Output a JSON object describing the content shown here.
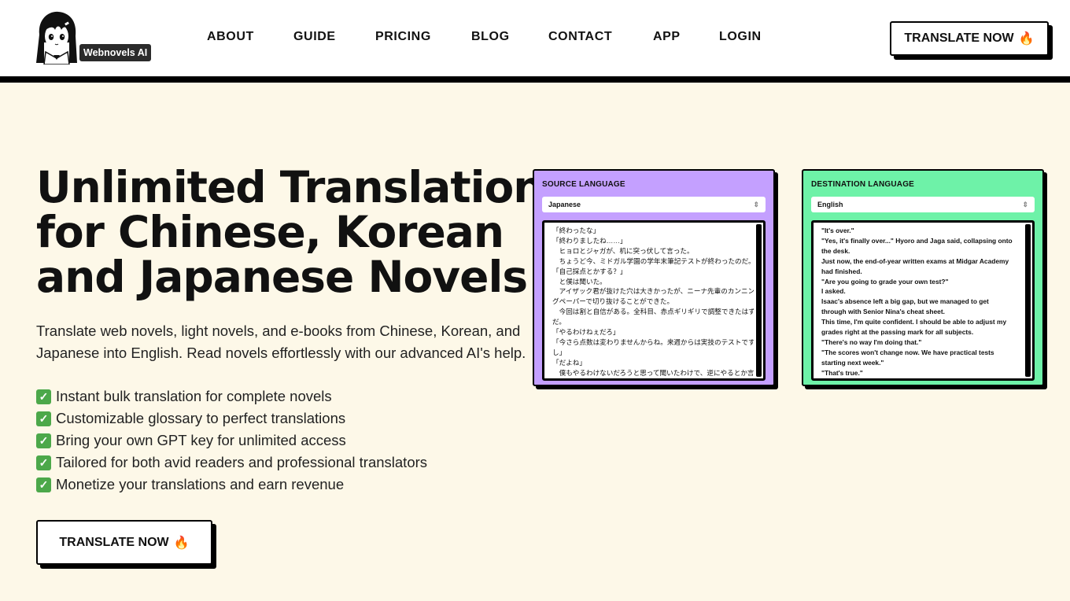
{
  "brand": {
    "name": "Webnovels AI"
  },
  "nav": {
    "items": [
      "ABOUT",
      "GUIDE",
      "PRICING",
      "BLOG",
      "CONTACT",
      "APP",
      "LOGIN"
    ]
  },
  "header_cta": {
    "label": "TRANSLATE NOW",
    "emoji": "🔥"
  },
  "hero": {
    "title_highlight": "Unlimited",
    "title_line1_rest": " Translation",
    "title_line2": "for Chinese, Korean",
    "title_line3": "and Japanese Novels",
    "description": "Translate web novels, light novels, and e-books from Chinese, Korean, and Japanese into English. Read novels effortlessly with our advanced AI's help.",
    "features": [
      "Instant bulk translation for complete novels",
      "Customizable glossary to perfect translations",
      "Bring your own GPT key for unlimited access",
      "Tailored for both avid readers and professional translators",
      "Monetize your translations and earn revenue"
    ],
    "cta_label": "TRANSLATE NOW",
    "cta_emoji": "🔥"
  },
  "source_panel": {
    "label": "SOURCE LANGUAGE",
    "selected": "Japanese",
    "lines": [
      "「終わったな」",
      "「終わりましたね……」",
      "　ヒョロとジャガが、机に突っ伏して言った。",
      "　ちょうど今、ミドガル学園の学年末筆記テストが終わったのだ。",
      "「自己採点とかする？」",
      "　と僕は聞いた。",
      "　アイザック君が抜けた穴は大きかったが、ニーナ先輩のカンニン",
      "グペーパーで切り抜けることができた。",
      "　今回は割と自信がある。全科目、赤点ギリギリで調整できたはず",
      "だ。",
      "「やるわけねぇだろ」",
      "「今さら点数は変わりませんからね。来週からは実技のテストです",
      "し」",
      "「だよね」",
      "　僕もやるわけないだろうと思って聞いたわけで、逆にやるとか言"
    ]
  },
  "destination_panel": {
    "label": "DESTINATION LANGUAGE",
    "selected": "English",
    "lines": [
      "\"It's over.\"",
      "\"Yes, it's finally over...\" Hyoro and Jaga said, collapsing onto",
      "the desk.",
      "Just now, the end-of-year written exams at Midgar Academy",
      "had finished.",
      "\"Are you going to grade your own test?\"",
      "I asked.",
      "Isaac's absence left a big gap, but we managed to get",
      "through with Senior Nina's cheat sheet.",
      "This time, I'm quite confident. I should be able to adjust my",
      "grades right at the passing mark for all subjects.",
      "\"There's no way I'm doing that.\"",
      "\"The scores won't change now. We have practical tests",
      "starting next week.\"",
      "\"That's true.\""
    ]
  },
  "colors": {
    "accent_purple": "#c4a0ff",
    "accent_green": "#6ef2a8",
    "background": "#fdf8e8"
  }
}
